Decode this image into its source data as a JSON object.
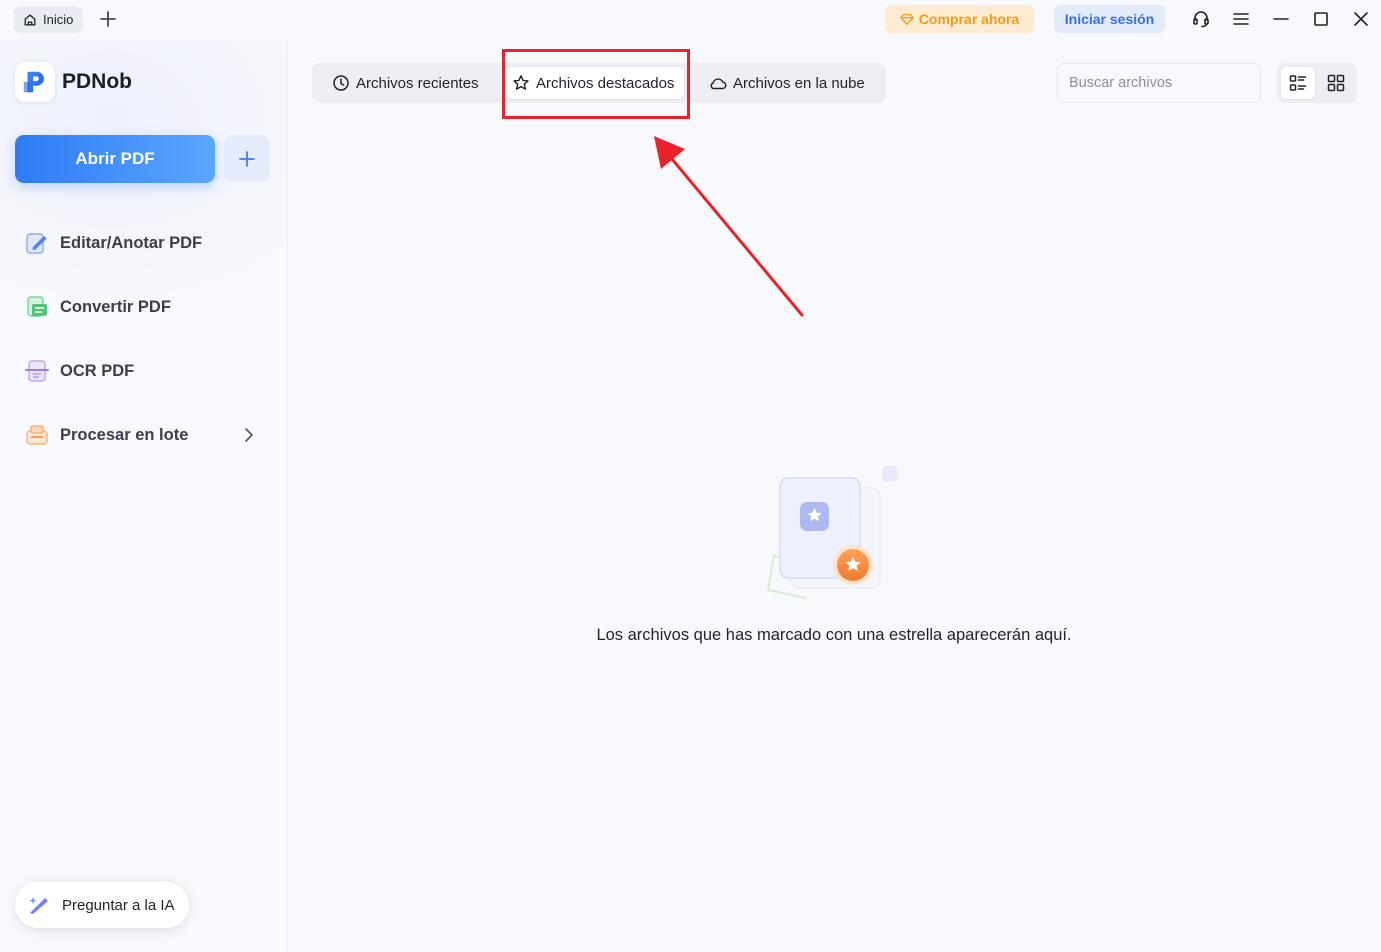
{
  "titlebar": {
    "home_tab_label": "Inicio",
    "buy_label": "Comprar ahora",
    "login_label": "Iniciar sesión"
  },
  "sidebar": {
    "app_name": "PDNob",
    "open_pdf_label": "Abrir PDF",
    "items": [
      {
        "label": "Editar/Anotar PDF",
        "icon": "edit-pdf-icon"
      },
      {
        "label": "Convertir PDF",
        "icon": "convert-pdf-icon"
      },
      {
        "label": "OCR PDF",
        "icon": "ocr-pdf-icon"
      },
      {
        "label": "Procesar en lote",
        "icon": "batch-process-icon"
      }
    ],
    "ask_ai_label": "Preguntar a la IA"
  },
  "main": {
    "tabs": [
      {
        "label": "Archivos recientes",
        "icon": "clock-icon"
      },
      {
        "label": "Archivos destacados",
        "icon": "star-icon",
        "active": true
      },
      {
        "label": "Archivos en la nube",
        "icon": "cloud-icon"
      }
    ],
    "search_placeholder": "Buscar archivos",
    "empty_message": "Los archivos que has marcado con una estrella aparecerán aquí."
  },
  "colors": {
    "accent": "#2f7bf5",
    "buy": "#f39a1a",
    "annotation": "#e8232b"
  }
}
